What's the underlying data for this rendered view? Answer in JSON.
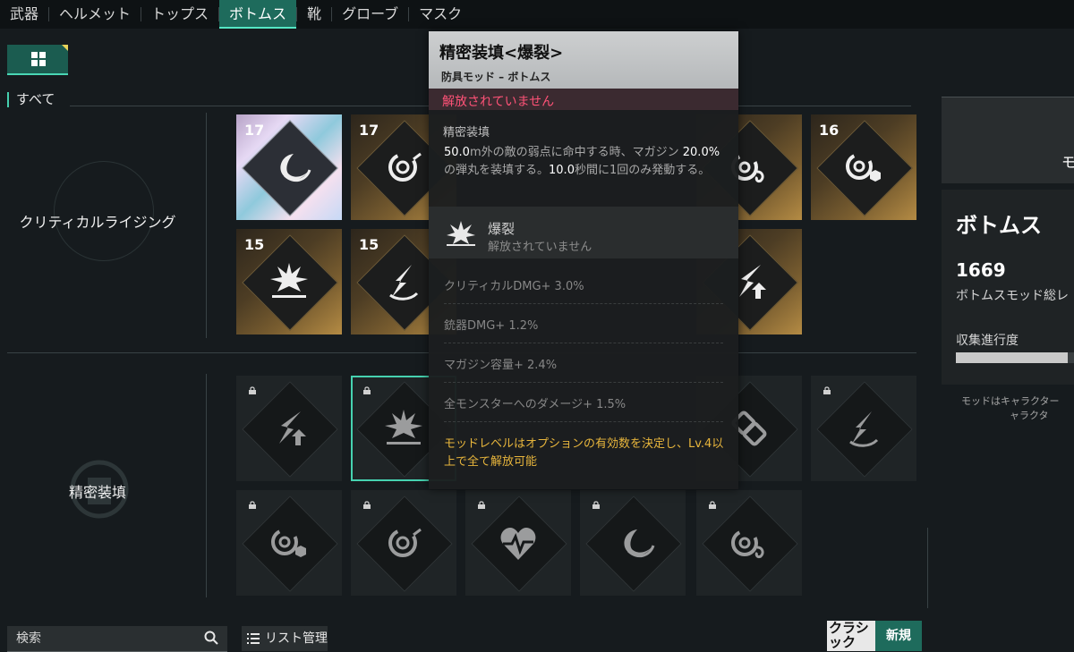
{
  "tabs": [
    {
      "label": "武器"
    },
    {
      "label": "ヘルメット"
    },
    {
      "label": "トップス"
    },
    {
      "label": "ボトムス",
      "active": true
    },
    {
      "label": "靴"
    },
    {
      "label": "グローブ"
    },
    {
      "label": "マスク"
    }
  ],
  "filter": {
    "label": "すべて"
  },
  "groups": [
    {
      "name": "クリティカルライジング"
    },
    {
      "name": "精密装填"
    }
  ],
  "cards": [
    {
      "level": "17",
      "style": "holo",
      "icon": "wave-icon"
    },
    {
      "level": "17",
      "style": "gold",
      "icon": "swirl-icon"
    },
    {
      "level": "",
      "style": "gold",
      "icon": "swirl-hook-icon"
    },
    {
      "level": "16",
      "style": "gold",
      "icon": "swirl-hex-icon"
    },
    {
      "level": "15",
      "style": "gold",
      "icon": "burst-icon"
    },
    {
      "level": "15",
      "style": "gold",
      "icon": "crack-arrow-icon"
    },
    {
      "level": "",
      "style": "gold",
      "icon": "slash-arrow-icon"
    },
    {
      "level": "",
      "style": "dark",
      "icon": "slash-arrow-icon",
      "locked": true
    },
    {
      "level": "",
      "style": "dark",
      "icon": "burst-icon",
      "locked": true,
      "selected": true
    },
    {
      "level": "",
      "style": "dark",
      "icon": "chain-icon",
      "locked": false
    },
    {
      "level": "",
      "style": "dark",
      "icon": "crack-arrow-icon",
      "locked": true
    },
    {
      "level": "",
      "style": "dark",
      "icon": "swirl-hex-icon",
      "locked": true
    },
    {
      "level": "",
      "style": "dark",
      "icon": "swirl-icon",
      "locked": true
    },
    {
      "level": "",
      "style": "dark",
      "icon": "heartbeat-icon",
      "locked": true
    },
    {
      "level": "",
      "style": "dark",
      "icon": "wave-icon",
      "locked": true
    },
    {
      "level": "",
      "style": "dark",
      "icon": "swirl-hook-icon",
      "locked": true
    }
  ],
  "tooltip": {
    "title": "精密装填<爆裂>",
    "subtitle": "防具モッド – ボトムス",
    "status": "解放されていません",
    "effect_name": "精密装填",
    "desc_parts": [
      "50.0",
      "m外の敵の弱点に命中する時、マガジン",
      "20.0%",
      "の弾丸を装填する。",
      "10.0",
      "秒間に1回のみ発動する。"
    ],
    "secondary": {
      "name": "爆裂",
      "status": "解放されていません"
    },
    "stats": [
      "クリティカルDMG+ 3.0%",
      "銃器DMG+ 1.2%",
      "マガジン容量+ 2.4%",
      "全モンスターへのダメージ+ 1.5%"
    ],
    "note": "モッドレベルはオプションの有効数を決定し、Lv.4以上で全て解放可能"
  },
  "right_panel": {
    "banner_text": "モ",
    "title": "ボトムス",
    "total": "1669",
    "total_label": "ボトムスモッド総レ",
    "progress_label": "収集進行度",
    "progress": 0.95,
    "note_line1": "モッドはキャラクター",
    "note_line2": "ャラクタ"
  },
  "bottom": {
    "search_placeholder": "検索",
    "list_button": "リスト管理",
    "classic_label": "クラシック",
    "new_label": "新規"
  },
  "colors": {
    "accent": "#1e6b5c",
    "accent_bright": "#46d2b0",
    "locked_text": "#ff5277",
    "note": "#e7b53c"
  }
}
